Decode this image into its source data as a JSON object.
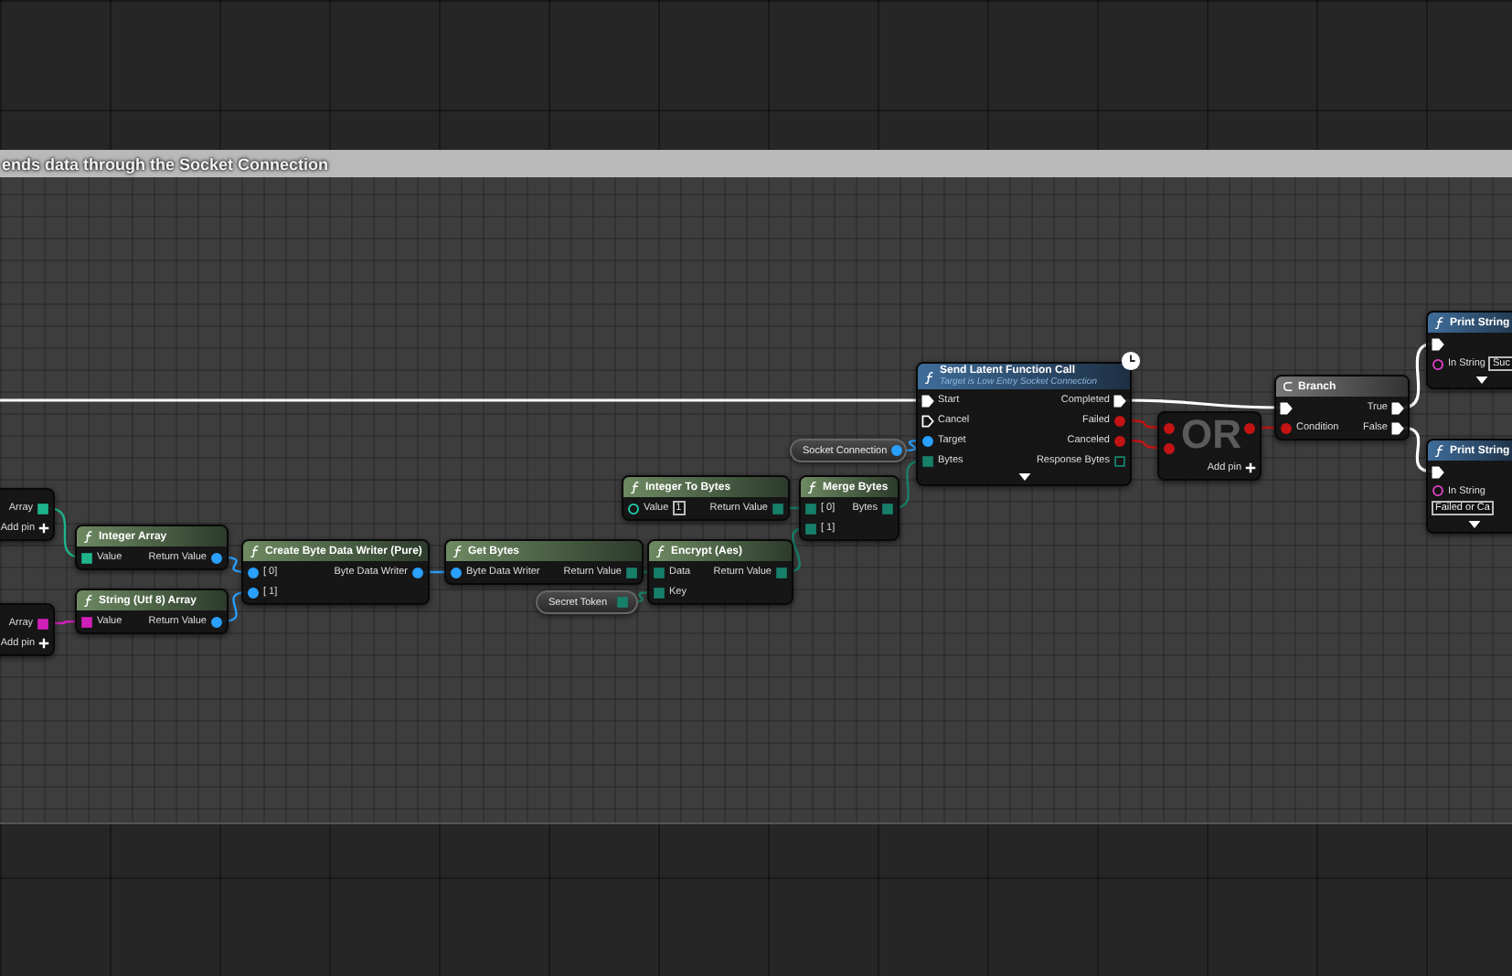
{
  "comment": {
    "title": "ends data through the Socket Connection"
  },
  "nodes": [
    {
      "kind": "partial",
      "outputs": [
        {
          "label": "Array",
          "kind": "integers",
          "connected": true
        }
      ],
      "add_pin": "Add pin"
    },
    {
      "kind": "partial",
      "outputs": [
        {
          "label": "Array",
          "kind": "strings",
          "connected": true
        }
      ],
      "add_pin": "Add pin"
    },
    {
      "kind": "pure",
      "title": "Integer Array",
      "inputs": [
        {
          "label": "Value",
          "kind": "integers",
          "connected": true
        }
      ],
      "outputs": [
        {
          "label": "Return Value",
          "kind": "object",
          "connected": true
        }
      ]
    },
    {
      "kind": "pure",
      "title": "String (Utf 8) Array",
      "inputs": [
        {
          "label": "Value",
          "kind": "strings",
          "connected": true
        }
      ],
      "outputs": [
        {
          "label": "Return Value",
          "kind": "object",
          "connected": true
        }
      ]
    },
    {
      "kind": "pure",
      "title": "Create Byte Data Writer (Pure)",
      "inputs": [
        {
          "label": "[ 0]",
          "kind": "object",
          "connected": true
        },
        {
          "label": "[ 1]",
          "kind": "object",
          "connected": true
        }
      ],
      "outputs": [
        {
          "label": "Byte Data Writer",
          "kind": "object",
          "connected": true
        }
      ]
    },
    {
      "kind": "pure",
      "title": "Get Bytes",
      "inputs": [
        {
          "label": "Byte Data Writer",
          "kind": "object",
          "connected": true
        }
      ],
      "outputs": [
        {
          "label": "Return Value",
          "kind": "bytes",
          "connected": true
        }
      ]
    },
    {
      "kind": "variable",
      "title": "Secret Token",
      "outputs": [
        {
          "kind": "bytes",
          "connected": true
        }
      ]
    },
    {
      "kind": "pure",
      "title": "Integer To Bytes",
      "inputs": [
        {
          "label": "Value",
          "kind": "integer",
          "connected": false,
          "value": "1"
        }
      ],
      "outputs": [
        {
          "label": "Return Value",
          "kind": "bytes",
          "connected": true
        }
      ]
    },
    {
      "kind": "pure",
      "title": "Encrypt (Aes)",
      "inputs": [
        {
          "label": "Data",
          "kind": "bytes",
          "connected": true
        },
        {
          "label": "Key",
          "kind": "bytes",
          "connected": true
        }
      ],
      "outputs": [
        {
          "label": "Return Value",
          "kind": "bytes",
          "connected": true
        }
      ]
    },
    {
      "kind": "variable",
      "title": "Socket Connection",
      "outputs": [
        {
          "kind": "object",
          "connected": true
        }
      ]
    },
    {
      "kind": "pure",
      "title": "Merge Bytes",
      "inputs": [
        {
          "label": "[ 0]",
          "kind": "bytes",
          "connected": true
        },
        {
          "label": "[ 1]",
          "kind": "bytes",
          "connected": true
        }
      ],
      "outputs": [
        {
          "label": "Bytes",
          "kind": "bytes",
          "connected": true
        }
      ]
    },
    {
      "kind": "impure",
      "title": "Send Latent Function Call",
      "subtitle": "Target is Low Entry Socket Connection",
      "latent": true,
      "expandable": true,
      "inputs": [
        {
          "label": "Start",
          "kind": "exec",
          "connected": true
        },
        {
          "label": "Cancel",
          "kind": "exec",
          "connected": false
        },
        {
          "label": "Target",
          "kind": "object",
          "connected": true
        },
        {
          "label": "Bytes",
          "kind": "bytes",
          "connected": true
        }
      ],
      "outputs": [
        {
          "label": "Completed",
          "kind": "exec",
          "connected": true
        },
        {
          "label": "Failed",
          "kind": "boolean",
          "connected": true
        },
        {
          "label": "Canceled",
          "kind": "boolean",
          "connected": true
        },
        {
          "label": "Response Bytes",
          "kind": "bytes",
          "connected": false
        }
      ]
    },
    {
      "kind": "or",
      "title": "OR",
      "inputs": [
        {
          "kind": "boolean",
          "connected": true
        },
        {
          "kind": "boolean",
          "connected": true
        }
      ],
      "outputs": [
        {
          "kind": "boolean",
          "connected": true
        }
      ],
      "add_pin": "Add pin"
    },
    {
      "kind": "branch",
      "title": "Branch",
      "inputs": [
        {
          "kind": "exec",
          "connected": true
        },
        {
          "label": "Condition",
          "kind": "boolean",
          "connected": true
        }
      ],
      "outputs": [
        {
          "label": "True",
          "kind": "exec",
          "connected": true
        },
        {
          "label": "False",
          "kind": "exec",
          "connected": true
        }
      ]
    },
    {
      "kind": "impure",
      "title": "Print String",
      "expandable": true,
      "inputs": [
        {
          "kind": "exec",
          "connected": true
        },
        {
          "label": "In String",
          "kind": "text",
          "connected": false,
          "value": "Suc"
        }
      ]
    },
    {
      "kind": "impure",
      "title": "Print String",
      "expandable": true,
      "inputs": [
        {
          "kind": "exec",
          "connected": true
        },
        {
          "label": "In String",
          "kind": "text",
          "connected": false,
          "value": "Failed or Ca"
        }
      ]
    }
  ]
}
